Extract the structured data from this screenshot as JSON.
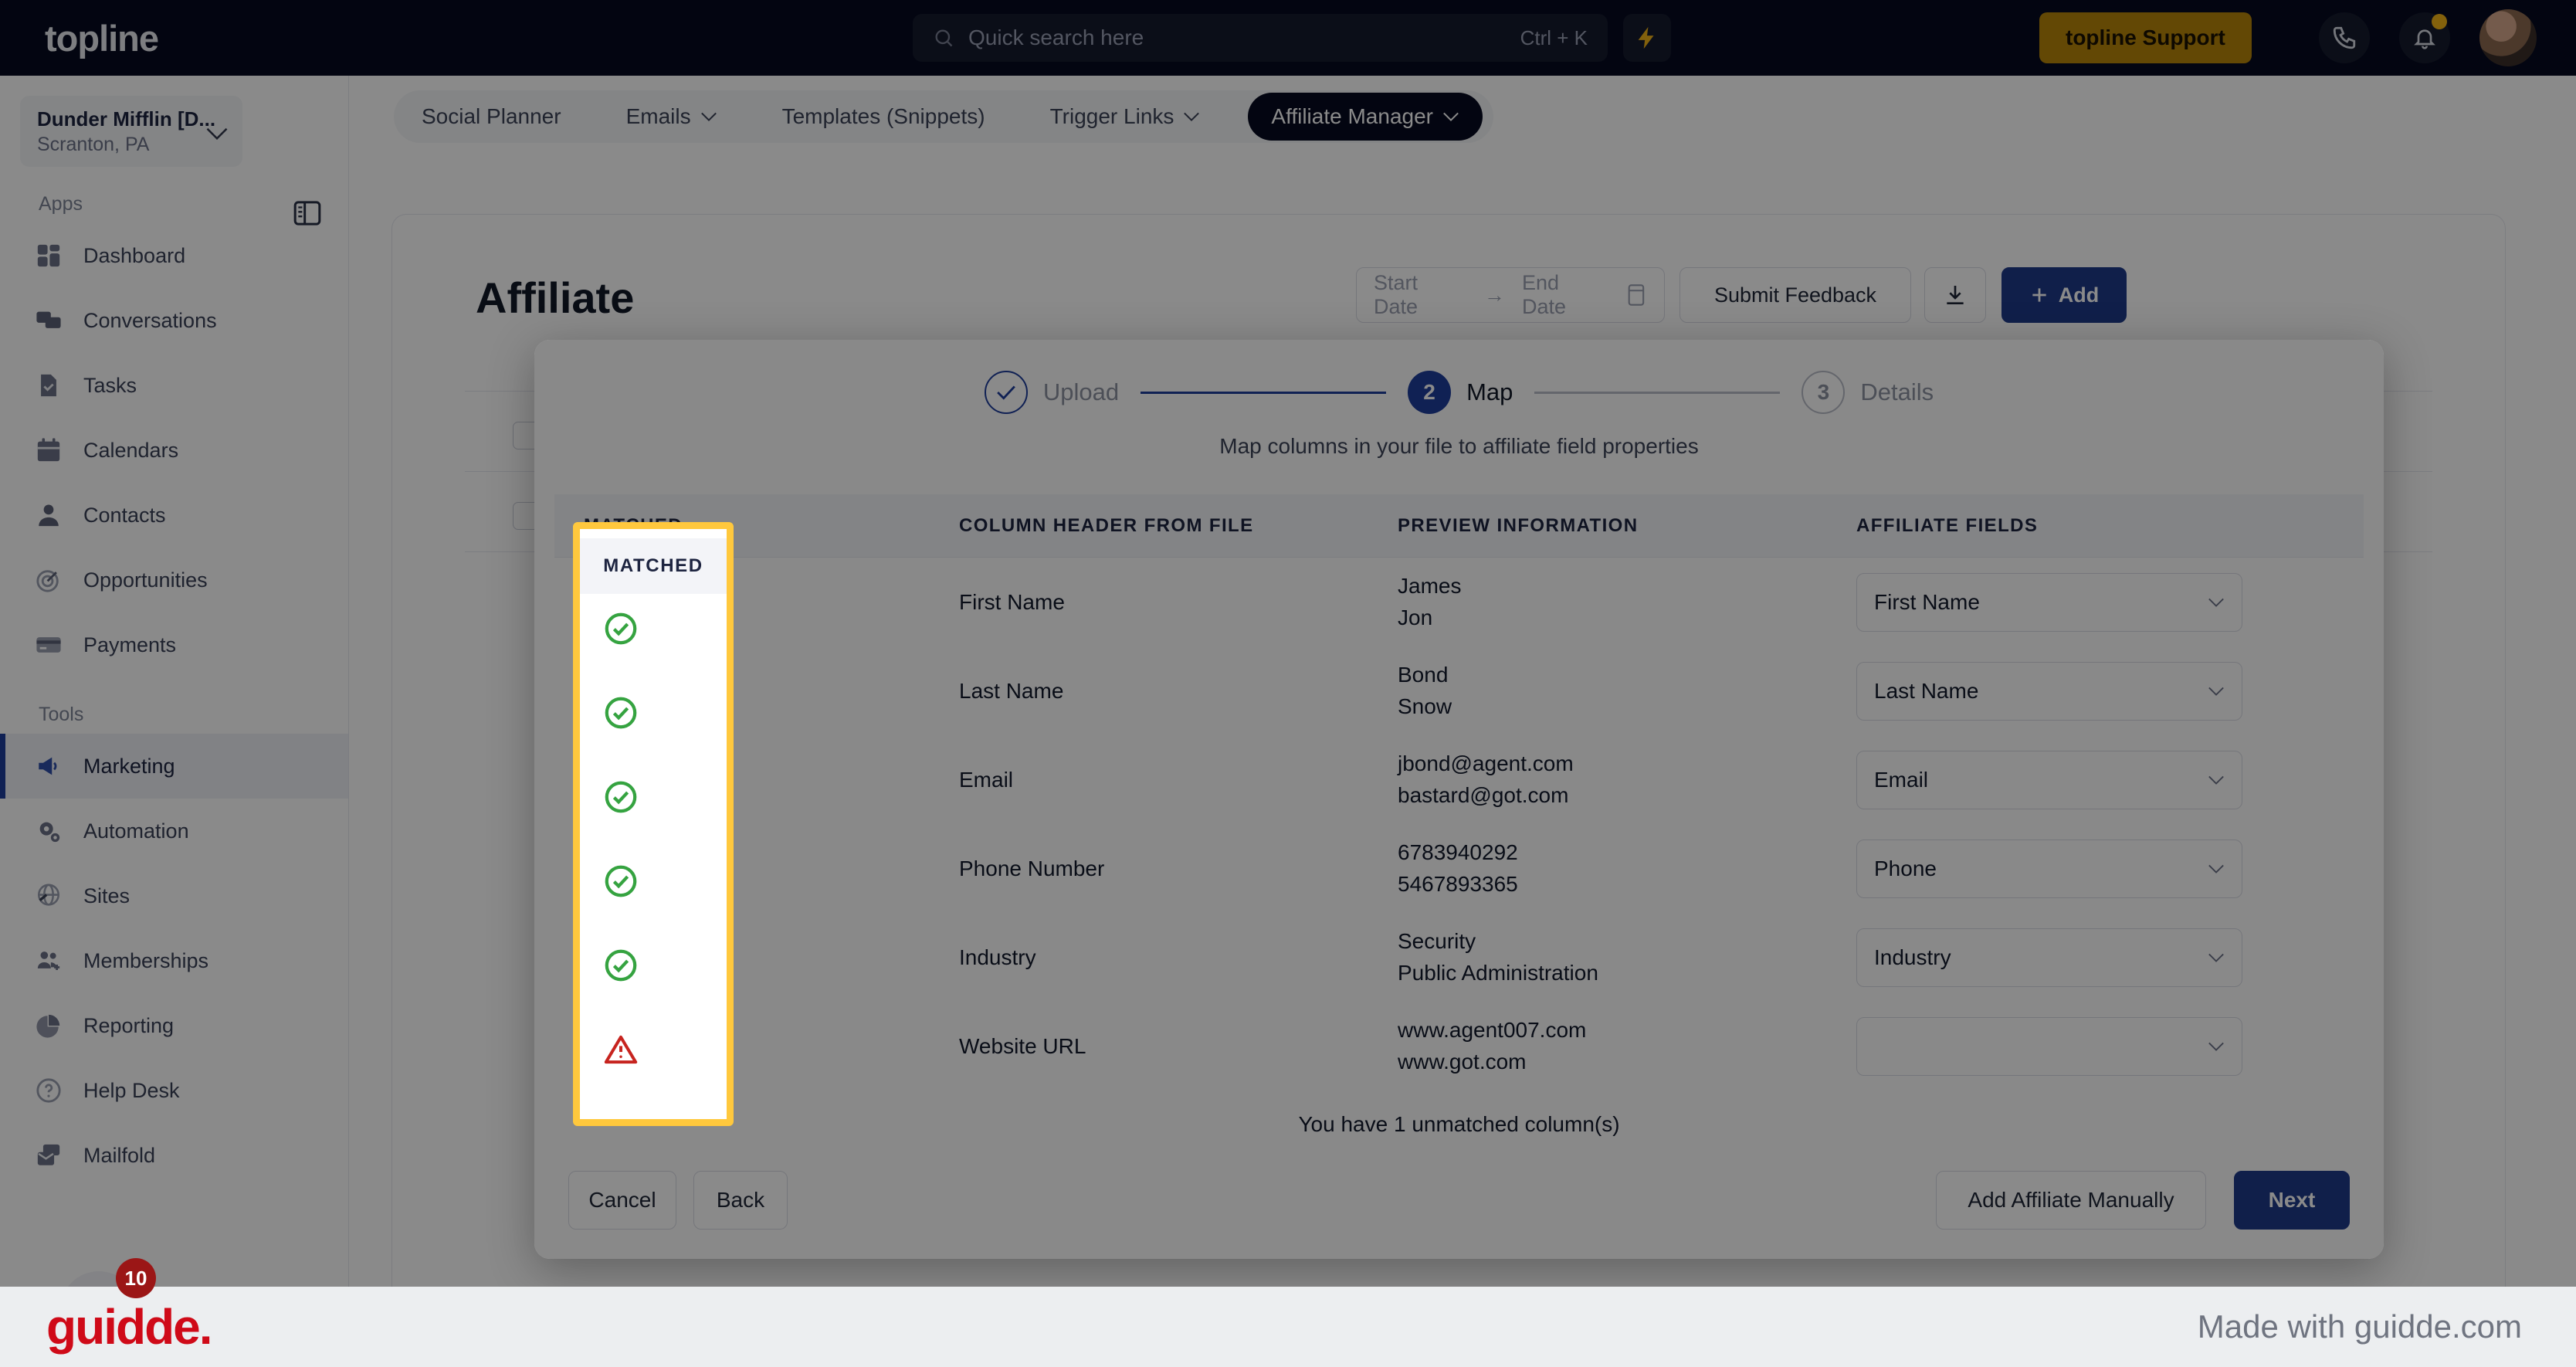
{
  "topbar": {
    "logo": "topline",
    "search_placeholder": "Quick search here",
    "search_shortcut": "Ctrl + K",
    "support_button": "topline Support",
    "icons": {
      "search": "search-icon",
      "bolt": "bolt-icon",
      "phone": "phone-icon",
      "bell": "bell-icon",
      "avatar": "avatar"
    }
  },
  "sidebar": {
    "org_name": "Dunder Mifflin [D...",
    "org_location": "Scranton, PA",
    "sections": [
      {
        "label": "Apps",
        "items": [
          {
            "label": "Dashboard",
            "icon": "dashboard-icon",
            "active": false
          },
          {
            "label": "Conversations",
            "icon": "chat-icon",
            "active": false
          },
          {
            "label": "Tasks",
            "icon": "task-icon",
            "active": false
          },
          {
            "label": "Calendars",
            "icon": "calendar-icon",
            "active": false
          },
          {
            "label": "Contacts",
            "icon": "contact-icon",
            "active": false
          },
          {
            "label": "Opportunities",
            "icon": "target-icon",
            "active": false
          },
          {
            "label": "Payments",
            "icon": "card-icon",
            "active": false
          }
        ]
      },
      {
        "label": "Tools",
        "items": [
          {
            "label": "Marketing",
            "icon": "megaphone-icon",
            "active": true
          },
          {
            "label": "Automation",
            "icon": "gear-icon",
            "active": false
          },
          {
            "label": "Sites",
            "icon": "globe-icon",
            "active": false
          },
          {
            "label": "Memberships",
            "icon": "members-icon",
            "active": false
          },
          {
            "label": "Reporting",
            "icon": "pie-icon",
            "active": false
          },
          {
            "label": "Help Desk",
            "icon": "question-icon",
            "active": false
          },
          {
            "label": "Mailfold",
            "icon": "mail-icon",
            "active": false
          }
        ]
      }
    ],
    "notification_badge": "10"
  },
  "nav_tabs": [
    {
      "label": "Social Planner",
      "caret": false,
      "active": false
    },
    {
      "label": "Emails",
      "caret": true,
      "active": false
    },
    {
      "label": "Templates (Snippets)",
      "caret": false,
      "active": false
    },
    {
      "label": "Trigger Links",
      "caret": true,
      "active": false
    },
    {
      "label": "Affiliate Manager",
      "caret": true,
      "active": true
    }
  ],
  "page": {
    "title": "Affiliate",
    "start_date_placeholder": "Start Date",
    "end_date_placeholder": "End Date",
    "feedback_button": "Submit Feedback",
    "add_button": "Add",
    "download_icon": "download-icon",
    "calendar_icon": "calendar-icon"
  },
  "modal": {
    "steps": [
      {
        "number": "1",
        "label": "Upload",
        "state": "done"
      },
      {
        "number": "2",
        "label": "Map",
        "state": "current"
      },
      {
        "number": "3",
        "label": "Details",
        "state": "todo"
      }
    ],
    "subtitle": "Map columns in your file to affiliate field properties",
    "columns": {
      "matched": "MATCHED",
      "header_from_file": "COLUMN HEADER FROM FILE",
      "preview": "PREVIEW INFORMATION",
      "affiliate_fields": "AFFILIATE FIELDS"
    },
    "rows": [
      {
        "matched": "check",
        "header": "First Name",
        "preview_1": "James",
        "preview_2": "Jon",
        "field": "First Name"
      },
      {
        "matched": "check",
        "header": "Last Name",
        "preview_1": "Bond",
        "preview_2": "Snow",
        "field": "Last Name"
      },
      {
        "matched": "check",
        "header": "Email",
        "preview_1": "jbond@agent.com",
        "preview_2": "bastard@got.com",
        "field": "Email"
      },
      {
        "matched": "check",
        "header": "Phone Number",
        "preview_1": "6783940292",
        "preview_2": "5467893365",
        "field": "Phone"
      },
      {
        "matched": "check",
        "header": "Industry",
        "preview_1": "Security",
        "preview_2": "Public Administration",
        "field": "Industry"
      },
      {
        "matched": "warn",
        "header": "Website URL",
        "preview_1": "www.agent007.com",
        "preview_2": "www.got.com",
        "field": ""
      }
    ],
    "unmatched_note": "You have 1 unmatched column(s)",
    "buttons": {
      "cancel": "Cancel",
      "back": "Back",
      "add_manually": "Add Affiliate Manually",
      "next": "Next"
    }
  },
  "highlight": {
    "title": "MATCHED",
    "border_color": "#ffc83d",
    "check_color": "#35a340",
    "warn_color": "#c7241f"
  },
  "banner": {
    "logo": "guidde.",
    "made_with": "Made with guidde.com",
    "logo_color": "#cf0a18"
  }
}
